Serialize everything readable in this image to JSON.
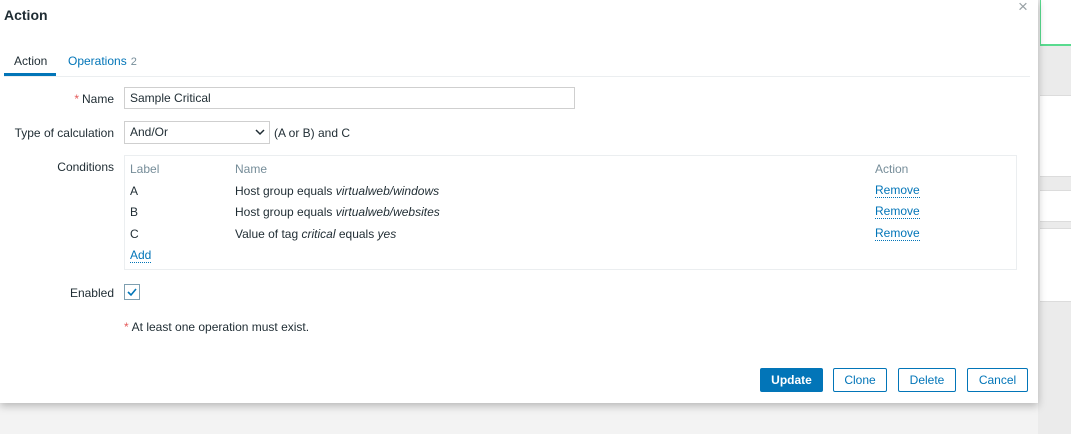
{
  "dialog": {
    "title": "Action",
    "close_glyph": "×"
  },
  "tabs": [
    {
      "label": "Action",
      "active": true
    },
    {
      "label": "Operations",
      "count": "2",
      "active": false
    }
  ],
  "form": {
    "name": {
      "label": "Name",
      "required_mark": "*",
      "value": "Sample Critical"
    },
    "calculation": {
      "label": "Type of calculation",
      "selected": "And/Or",
      "formula": "(A or B) and C"
    },
    "conditions": {
      "label": "Conditions",
      "headers": {
        "label": "Label",
        "name": "Name",
        "action": "Action"
      },
      "rows": [
        {
          "label": "A",
          "prefix": "Host group equals ",
          "value": "virtualweb/windows",
          "suffix": "",
          "action": "Remove"
        },
        {
          "label": "B",
          "prefix": "Host group equals ",
          "value": "virtualweb/websites",
          "suffix": "",
          "action": "Remove"
        },
        {
          "label": "C",
          "prefix": "Value of tag ",
          "value": "critical",
          "mid": " equals ",
          "value2": "yes",
          "action": "Remove"
        }
      ],
      "add_label": "Add"
    },
    "enabled": {
      "label": "Enabled",
      "checked": true
    },
    "note": {
      "required_mark": "*",
      "text": "At least one operation must exist."
    }
  },
  "buttons": {
    "update": "Update",
    "clone": "Clone",
    "delete": "Delete",
    "cancel": "Cancel"
  },
  "colors": {
    "accent": "#0275b8",
    "required": "#e45959",
    "muted": "#768d99",
    "success": "#59db8f"
  },
  "icons": {
    "close": "close-icon",
    "select_arrow": "chevron-down-icon",
    "check": "check-icon"
  }
}
